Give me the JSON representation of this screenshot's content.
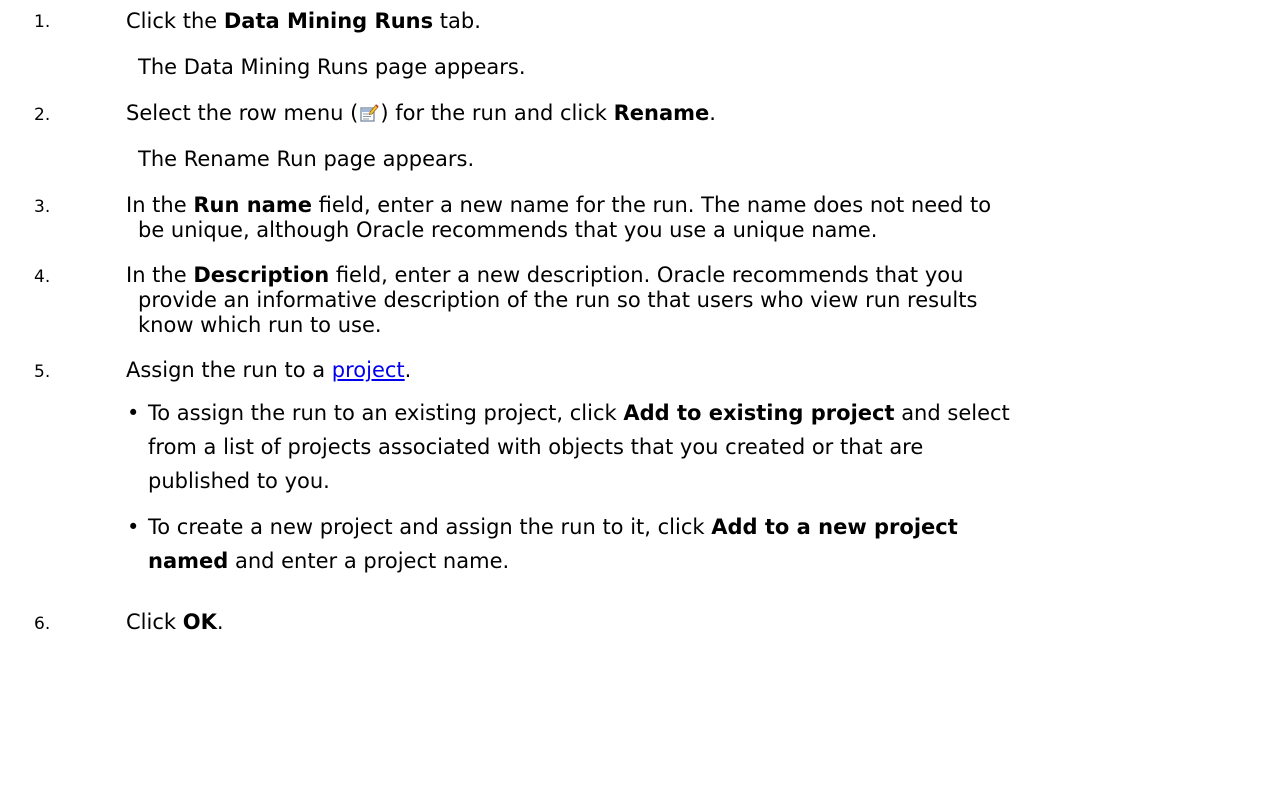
{
  "steps": [
    {
      "number": "1.",
      "parts": {
        "pre": "Click the ",
        "bold": "Data Mining Runs",
        "post": " tab."
      },
      "result": "The Data Mining Runs page appears."
    },
    {
      "number": "2.",
      "parts": {
        "pre": "Select the row menu (",
        "mid": ") for the run and click ",
        "bold": "Rename",
        "post": "."
      },
      "icon": "row-menu-icon",
      "result": "The Rename Run page appears."
    },
    {
      "number": "3.",
      "parts": {
        "pre": "In the ",
        "bold": "Run name",
        "post": " field, enter a new name for the run. The name does not need to"
      },
      "cont": "be unique, although Oracle recommends that you use a unique name."
    },
    {
      "number": "4.",
      "parts": {
        "pre": "In the ",
        "bold": "Description",
        "post": " field, enter a new description. Oracle recommends that you"
      },
      "cont1": "provide an informative description of the run so that users who view run results",
      "cont2": "know which run to use."
    },
    {
      "number": "5.",
      "parts": {
        "pre": "Assign the run to a ",
        "link": "project",
        "post": "."
      },
      "bullets": [
        {
          "pre": "To assign the run to an existing project, click ",
          "bold": "Add to existing project",
          "post": " and select",
          "line2": "from a list of projects associated with objects that you created or that are",
          "line3": "published to you."
        },
        {
          "pre": "To create a new project and assign the run to it, click ",
          "bold": "Add to a new project",
          "line2_bold": "named",
          "line2_post": " and enter a project name."
        }
      ]
    },
    {
      "number": "6.",
      "parts": {
        "pre": "Click ",
        "bold": "OK",
        "post": "."
      }
    }
  ],
  "colors": {
    "text": "#000000",
    "link": "#0000ee"
  }
}
